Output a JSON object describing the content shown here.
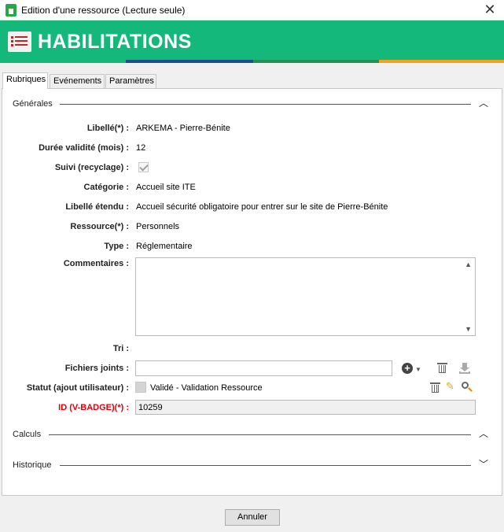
{
  "window": {
    "title": "Edition d'une ressource (Lecture seule)",
    "close_symbol": "✕"
  },
  "banner": {
    "title": "HABILITATIONS",
    "icon": "list-icon",
    "color": "#15b87b",
    "stripe_colors": [
      "#1d4f8c",
      "#2a8f56",
      "#f4a21c"
    ]
  },
  "tabs": [
    {
      "label": "Rubriques",
      "active": true
    },
    {
      "label": "Evénements",
      "active": false
    },
    {
      "label": "Paramètres",
      "active": false
    }
  ],
  "sections": {
    "generales": {
      "label": "Générales",
      "expanded": true
    },
    "calculs": {
      "label": "Calculs",
      "expanded": true
    },
    "historique": {
      "label": "Historique",
      "expanded": false
    }
  },
  "fields": {
    "libelle": {
      "label": "Libellé(*) :",
      "value": "ARKEMA - Pierre-Bénite"
    },
    "duree": {
      "label": "Durée validité (mois) :",
      "value": "12"
    },
    "suivi": {
      "label": "Suivi (recyclage) :",
      "checked": true
    },
    "categorie": {
      "label": "Catégorie :",
      "value": "Accueil site ITE"
    },
    "libelle_etendu": {
      "label": "Libellé étendu :",
      "value": "Accueil sécurité obligatoire pour entrer sur le site de Pierre-Bénite"
    },
    "ressource": {
      "label": "Ressource(*) :",
      "value": "Personnels"
    },
    "type": {
      "label": "Type :",
      "value": "Réglementaire"
    },
    "commentaires": {
      "label": "Commentaires :",
      "value": ""
    },
    "tri": {
      "label": "Tri :",
      "value": ""
    },
    "fichiers": {
      "label": "Fichiers joints :",
      "value": ""
    },
    "statut": {
      "label": "Statut (ajout utilisateur) :",
      "value": "Validé - Validation Ressource"
    },
    "id_badge": {
      "label": "ID (V-BADGE)(*) :",
      "value": "10259",
      "label_color": "#e0000b"
    }
  },
  "footer": {
    "cancel_label": "Annuler"
  }
}
